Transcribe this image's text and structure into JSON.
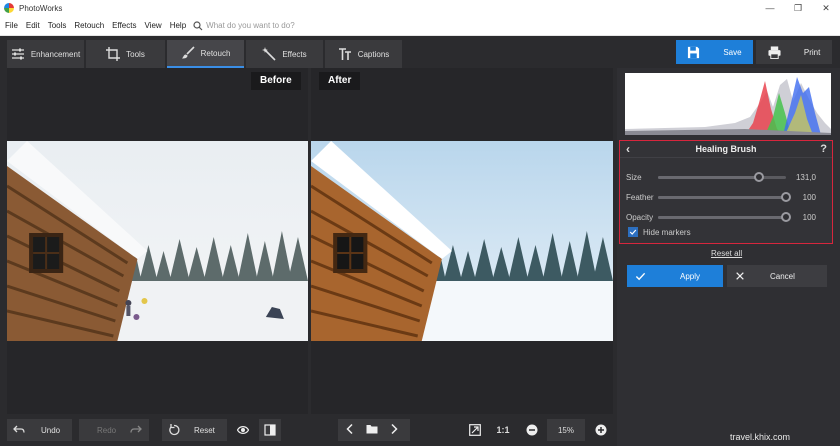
{
  "window": {
    "title": "PhotoWorks",
    "minimize": "—",
    "maximize": "❐",
    "close": "✕"
  },
  "menu": {
    "items": [
      "File",
      "Edit",
      "Tools",
      "Retouch",
      "Effects",
      "View",
      "Help"
    ],
    "search_placeholder": "What do you want to do?"
  },
  "toolbar": {
    "tabs": [
      {
        "label": "Enhancement",
        "icon": "sliders-icon"
      },
      {
        "label": "Tools",
        "icon": "crop-icon"
      },
      {
        "label": "Retouch",
        "icon": "brush-icon",
        "active": true
      },
      {
        "label": "Effects",
        "icon": "magic-wand-icon"
      },
      {
        "label": "Captions",
        "icon": "text-icon"
      }
    ],
    "save_label": "Save",
    "print_label": "Print"
  },
  "preview": {
    "before_label": "Before",
    "after_label": "After"
  },
  "healing": {
    "title": "Healing Brush",
    "help": "?",
    "sliders": [
      {
        "label": "Size",
        "value": "131,0",
        "fraction": 0.79
      },
      {
        "label": "Feather",
        "value": "100",
        "fraction": 1.0
      },
      {
        "label": "Opacity",
        "value": "100",
        "fraction": 1.0
      }
    ],
    "hide_markers_label": "Hide markers",
    "hide_markers_checked": true
  },
  "actions": {
    "reset_all": "Reset all",
    "apply": "Apply",
    "cancel": "Cancel"
  },
  "bottom": {
    "undo": "Undo",
    "redo": "Redo",
    "reset": "Reset",
    "ratio": "1:1",
    "zoom": "15%"
  },
  "colors": {
    "accent": "#1e7fd9",
    "panel_border": "#d7263d"
  },
  "watermark": "travel.khix.com"
}
